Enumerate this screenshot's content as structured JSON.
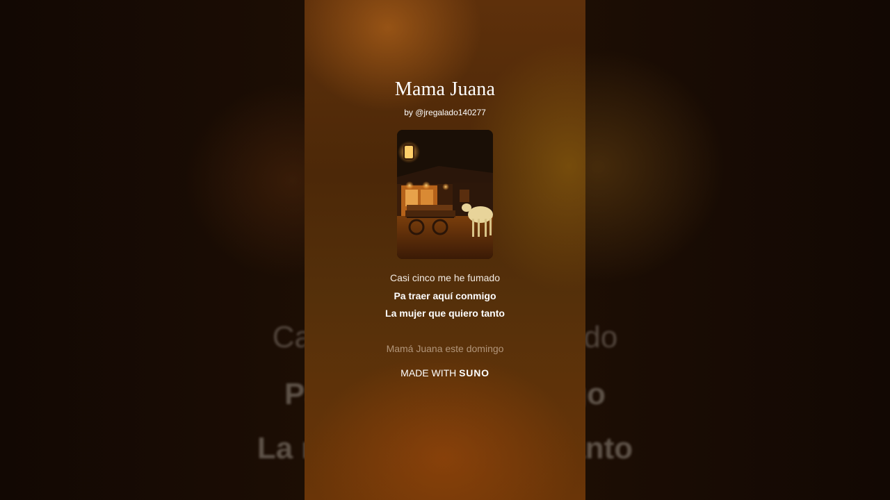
{
  "song": {
    "title": "Mama Juana",
    "artist": "by @jregalado140277"
  },
  "lyrics": {
    "line1": "Casi cinco me he fumado",
    "line2": "Pa traer aquí conmigo",
    "line3": "La mujer que quiero tanto",
    "next_line": "Mamá Juana este domingo"
  },
  "background_lyrics": {
    "line1": "Casi cinco me he fumado",
    "line2": "Pa traer aquí conmigo",
    "line3": "La mujer que quiero tanto"
  },
  "footer": {
    "made_with_label": "MADE WITH",
    "brand": "SUNO"
  },
  "cover": {
    "icon": "album-cover-night-cart-cow"
  },
  "colors": {
    "card_top": "#5e300b",
    "card_bottom": "#6a3508",
    "text": "#ffffff",
    "dim_text": "#e6d2be"
  }
}
